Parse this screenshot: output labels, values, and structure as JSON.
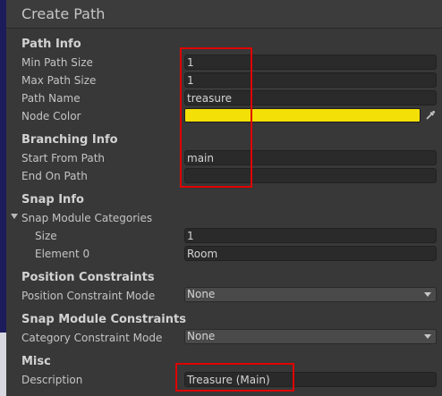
{
  "window": {
    "title": "Create Path"
  },
  "path_info": {
    "header": "Path Info",
    "min_path_size": {
      "label": "Min Path Size",
      "value": "1"
    },
    "max_path_size": {
      "label": "Max Path Size",
      "value": "1"
    },
    "path_name": {
      "label": "Path Name",
      "value": "treasure"
    },
    "node_color": {
      "label": "Node Color",
      "color": "#f3e006"
    }
  },
  "branching_info": {
    "header": "Branching Info",
    "start_from_path": {
      "label": "Start From Path",
      "value": "main"
    },
    "end_on_path": {
      "label": "End On Path",
      "value": ""
    }
  },
  "snap_info": {
    "header": "Snap Info",
    "categories": {
      "label": "Snap Module Categories",
      "size": {
        "label": "Size",
        "value": "1"
      },
      "element0": {
        "label": "Element 0",
        "value": "Room"
      }
    }
  },
  "position_constraints": {
    "header": "Position Constraints",
    "mode": {
      "label": "Position Constraint Mode",
      "value": "None"
    }
  },
  "snap_module_constraints": {
    "header": "Snap Module Constraints",
    "mode": {
      "label": "Category Constraint Mode",
      "value": "None"
    }
  },
  "misc": {
    "header": "Misc",
    "description": {
      "label": "Description",
      "value": "Treasure (Main)"
    }
  }
}
